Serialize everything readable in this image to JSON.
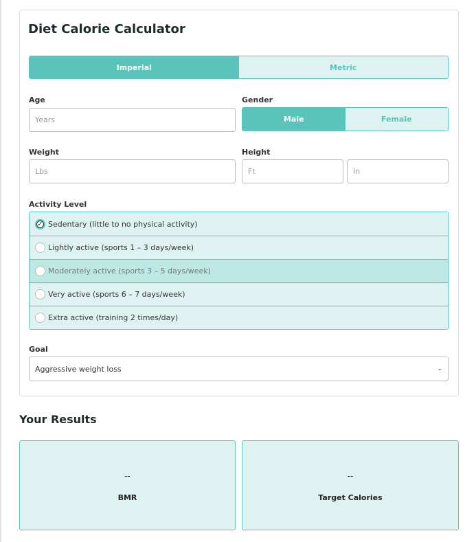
{
  "title": "Diet Calorie Calculator",
  "units": {
    "options": [
      "Imperial",
      "Metric"
    ],
    "selected": "Imperial"
  },
  "age": {
    "label": "Age",
    "placeholder": "Years"
  },
  "gender": {
    "label": "Gender",
    "options": [
      "Male",
      "Female"
    ],
    "selected": "Male"
  },
  "weight": {
    "label": "Weight",
    "placeholder": "Lbs"
  },
  "height": {
    "label": "Height",
    "ft_placeholder": "Ft",
    "in_placeholder": "In"
  },
  "activity": {
    "label": "Activity Level",
    "options": [
      "Sedentary (little to no physical activity)",
      "Lightly active (sports 1 – 3 days/week)",
      "Moderately active (sports 3 – 5 days/week)",
      "Very active (sports 6 – 7 days/week)",
      "Extra active (training 2 times/day)"
    ],
    "selected": 0
  },
  "goal": {
    "label": "Goal",
    "value": "Aggressive weight loss"
  },
  "results": {
    "heading": "Your Results",
    "bmr": {
      "value": "--",
      "label": "BMR"
    },
    "target": {
      "value": "--",
      "label": "Target Calories"
    }
  },
  "colors": {
    "accent": "#5ac4bb",
    "accent_light": "#def3f1"
  }
}
